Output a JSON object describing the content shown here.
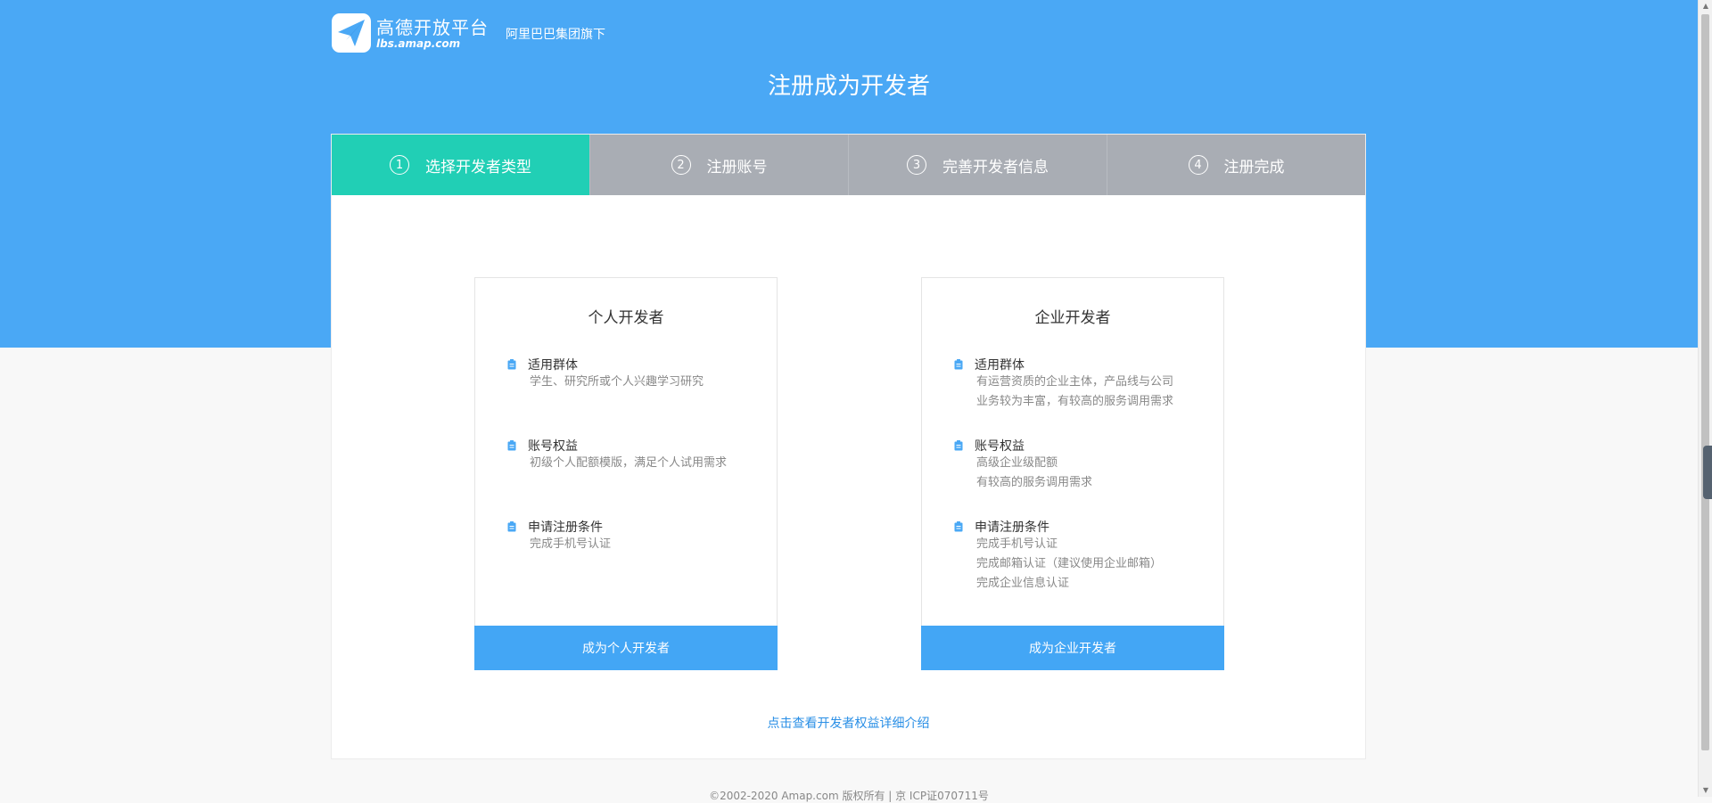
{
  "header": {
    "logo_name": "高德开放平台",
    "logo_domain": "lbs.amap.com",
    "slogan": "阿里巴巴集团旗下",
    "page_title": "注册成为开发者"
  },
  "steps": [
    {
      "num": "1",
      "label": "选择开发者类型",
      "active": true
    },
    {
      "num": "2",
      "label": "注册账号",
      "active": false
    },
    {
      "num": "3",
      "label": "完善开发者信息",
      "active": false
    },
    {
      "num": "4",
      "label": "注册完成",
      "active": false
    }
  ],
  "cards": [
    {
      "title": "个人开发者",
      "features": [
        {
          "heading": "适用群体",
          "lines": [
            "学生、研究所或个人兴趣学习研究"
          ]
        },
        {
          "heading": "账号权益",
          "lines": [
            "初级个人配额模版，满足个人试用需求"
          ]
        },
        {
          "heading": "申请注册条件",
          "lines": [
            "完成手机号认证"
          ]
        }
      ],
      "button": "成为个人开发者"
    },
    {
      "title": "企业开发者",
      "features": [
        {
          "heading": "适用群体",
          "lines": [
            "有运营资质的企业主体，产品线与公司",
            "业务较为丰富，有较高的服务调用需求"
          ]
        },
        {
          "heading": "账号权益",
          "lines": [
            "高级企业级配额",
            "有较高的服务调用需求"
          ]
        },
        {
          "heading": "申请注册条件",
          "lines": [
            "完成手机号认证",
            "完成邮箱认证（建议使用企业邮箱）",
            "完成企业信息认证"
          ]
        }
      ],
      "button": "成为企业开发者"
    }
  ],
  "detail_link": "点击查看开发者权益详细介绍",
  "footer": "©2002-2020 Amap.com 版权所有 | 京 ICP证070711号",
  "colors": {
    "hero": "#4aa8f5",
    "step_active": "#21cfb5",
    "step_inactive": "#a9adb4",
    "button": "#43a6f5",
    "link": "#2a8fe6"
  },
  "icons": {
    "logo": "paper-plane-icon",
    "feature": "document-icon"
  }
}
